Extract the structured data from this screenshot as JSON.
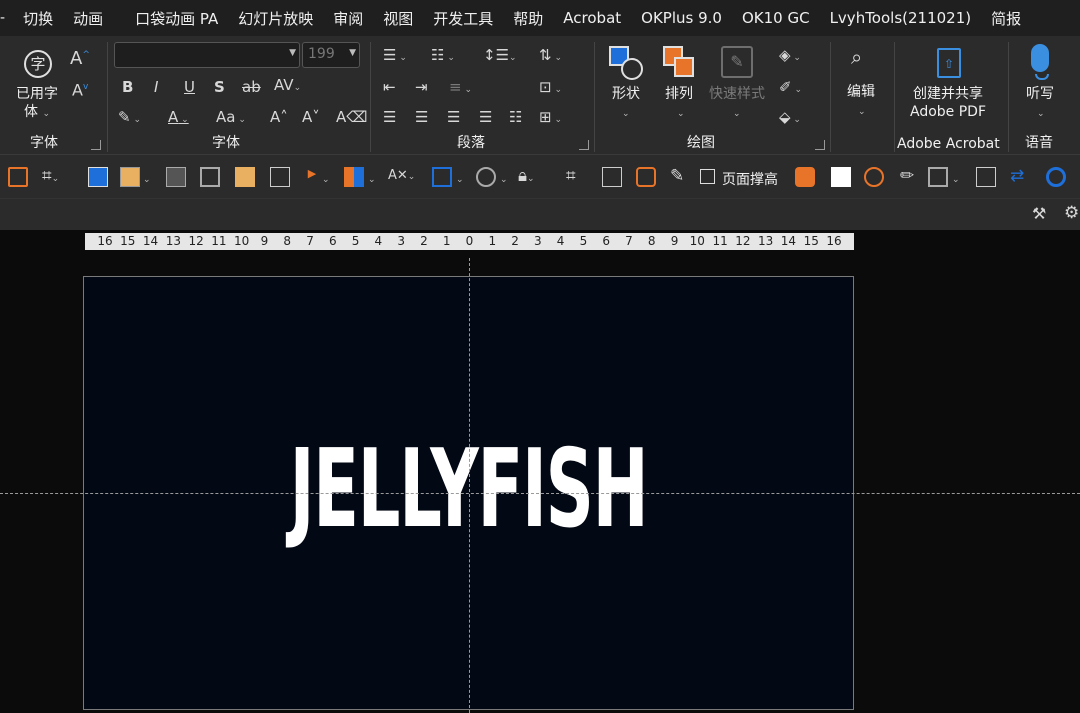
{
  "menu_tabs": [
    "切换",
    "动画",
    "口袋动画 PA",
    "幻灯片放映",
    "审阅",
    "视图",
    "开发工具",
    "帮助",
    "Acrobat",
    "OKPlus 9.0",
    "OK10 GC",
    "LvyhTools(211021)",
    "简报"
  ],
  "ribbon": {
    "used_fonts": {
      "line1": "已用字",
      "line2": "体",
      "group_label": "字体"
    },
    "font": {
      "font_name": "",
      "font_size": "199",
      "group_label": "字体"
    },
    "paragraph": {
      "group_label": "段落"
    },
    "drawing": {
      "shape_label": "形状",
      "arrange_label": "排列",
      "quick_styles_label": "快速样式",
      "group_label": "绘图"
    },
    "editing": {
      "label": "编辑"
    },
    "acrobat": {
      "line1": "创建并共享",
      "line2": "Adobe PDF",
      "group_label": "Adobe Acrobat"
    },
    "voice": {
      "dictate_label": "听写",
      "group_label": "语音"
    }
  },
  "quick_toolbar": {
    "fit_height_label": "页面撑高"
  },
  "ruler": {
    "ticks": [
      "16",
      "15",
      "14",
      "13",
      "12",
      "11",
      "10",
      "9",
      "8",
      "7",
      "6",
      "5",
      "4",
      "3",
      "2",
      "1",
      "0",
      "1",
      "2",
      "3",
      "4",
      "5",
      "6",
      "7",
      "8",
      "9",
      "10",
      "11",
      "12",
      "13",
      "14",
      "15",
      "16"
    ]
  },
  "slide": {
    "title": "JELLYFISH",
    "background": "#020814"
  },
  "colors": {
    "accent_blue": "#1e6fd9",
    "orange": "#e8742a",
    "ribbon_bg": "#2b2b2b",
    "tab_bg": "#1f1f1f"
  }
}
